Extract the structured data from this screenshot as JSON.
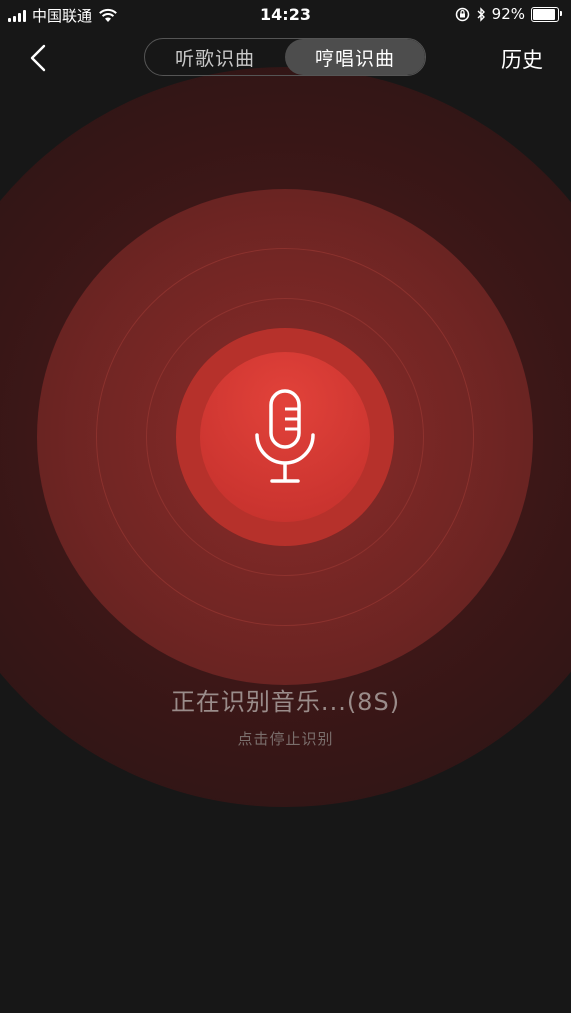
{
  "status_bar": {
    "carrier": "中国联通",
    "time": "14:23",
    "battery_percent": "92%",
    "battery_level": 0.92,
    "icons": [
      "signal-icon",
      "wifi-icon",
      "orientation-lock-icon",
      "bluetooth-icon",
      "battery-icon"
    ]
  },
  "nav": {
    "back_icon": "chevron-left-icon",
    "tabs": [
      {
        "label": "听歌识曲",
        "active": false
      },
      {
        "label": "哼唱识曲",
        "active": true
      }
    ],
    "history_label": "历史"
  },
  "recognizer": {
    "icon": "microphone-icon",
    "status": "正在识别音乐...(8S)",
    "hint": "点击停止识别"
  },
  "colors": {
    "background": "#171717",
    "accent": "#cc3530",
    "text_dim": "#9a8c8a"
  }
}
